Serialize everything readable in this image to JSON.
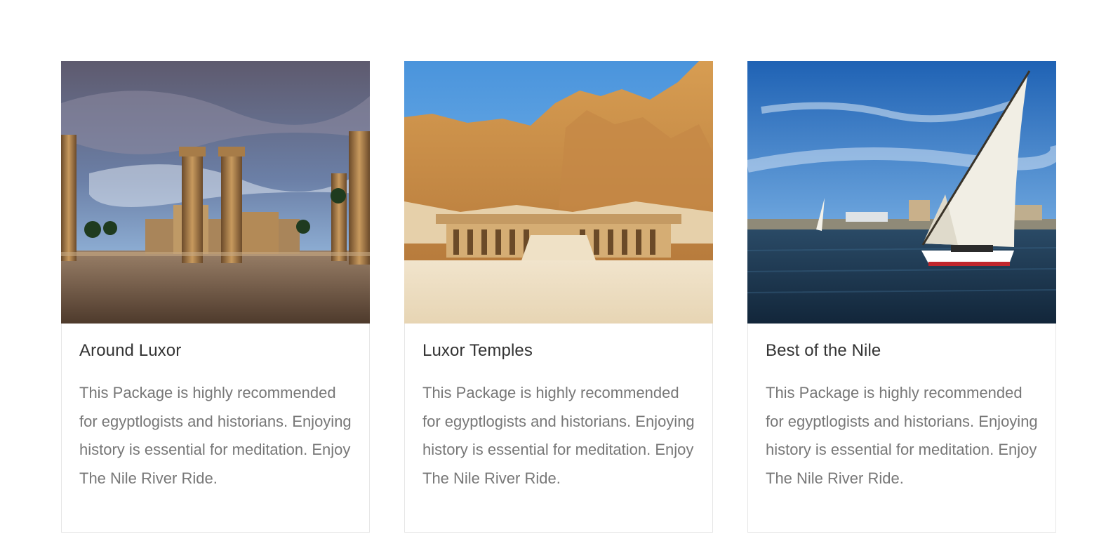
{
  "packages": [
    {
      "title": "Around Luxor",
      "description": "This Package is highly recommended for egyptlogists and historians. Enjoying history is essential for meditation. Enjoy The Nile River Ride.",
      "image": "luxor-temple-columns-photo"
    },
    {
      "title": "Luxor Temples",
      "description": "This Package is highly recommended for egyptlogists and historians. Enjoying history is essential for meditation. Enjoy The Nile River Ride.",
      "image": "hatshepsut-temple-cliffs-photo"
    },
    {
      "title": "Best of the Nile",
      "description": "This Package is highly recommended for egyptlogists and historians. Enjoying history is essential for meditation. Enjoy The Nile River Ride.",
      "image": "nile-felucca-sailboat-photo"
    }
  ],
  "colors": {
    "title": "#333333",
    "text": "#777777",
    "card_border": "#e6e6e6"
  }
}
